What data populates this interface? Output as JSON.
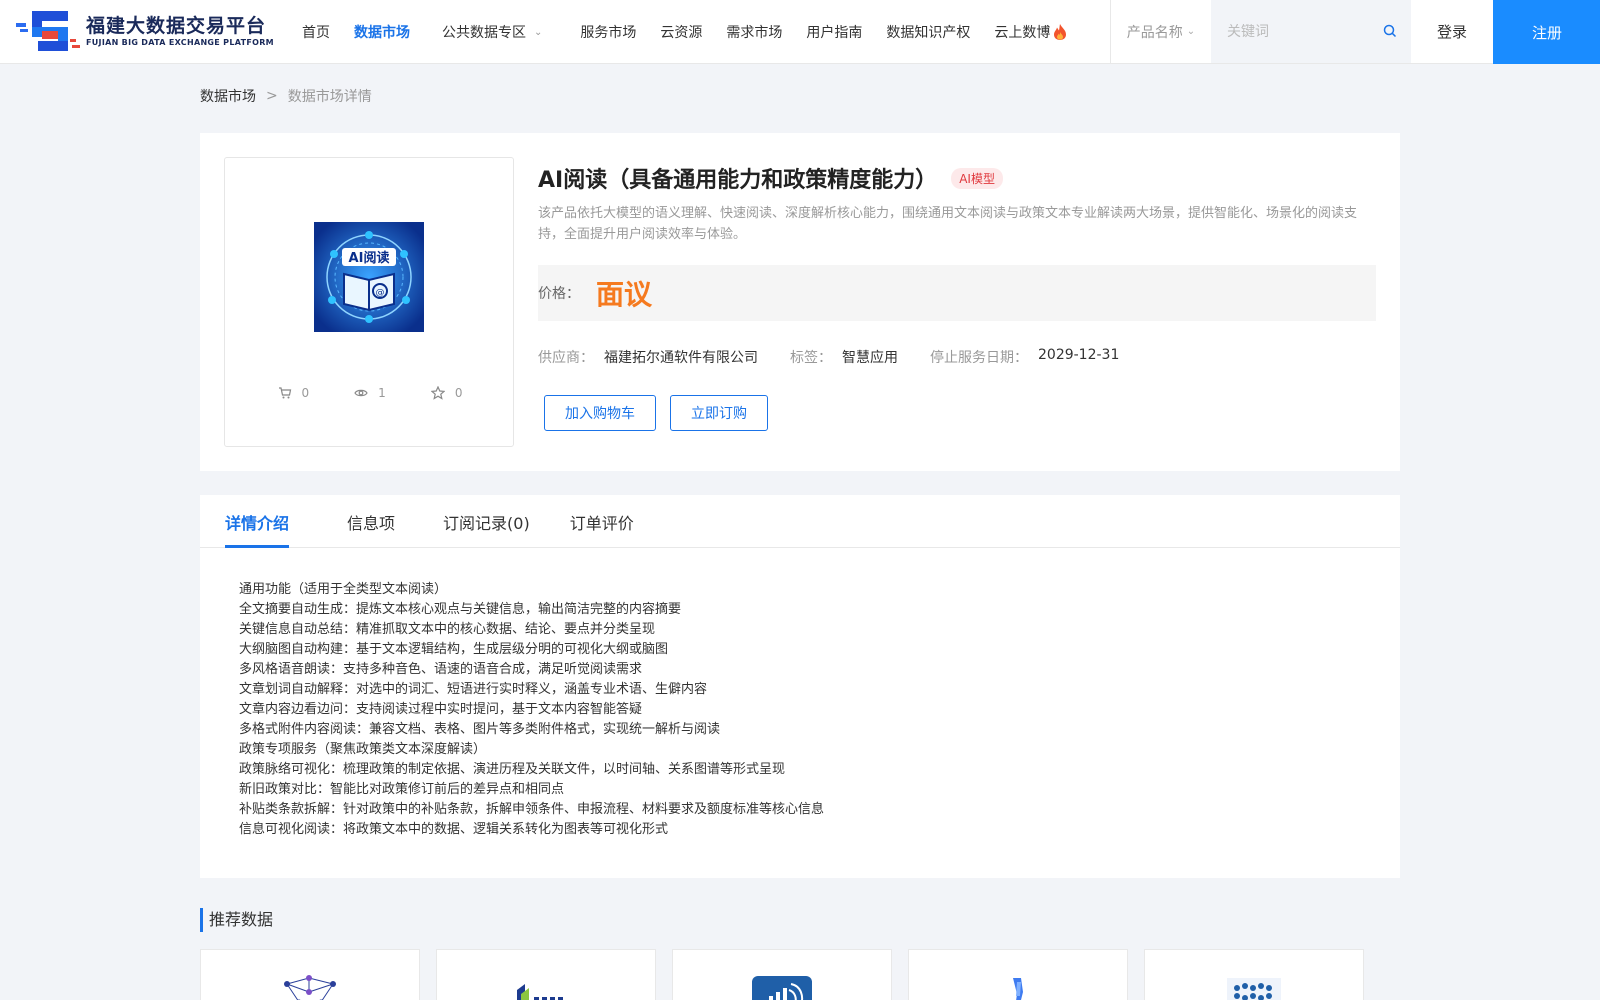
{
  "header": {
    "logo_cn": "福建大数据交易平台",
    "logo_en": "FUJIAN BIG DATA EXCHANGE  PLATFORM",
    "nav": [
      {
        "label": "首页",
        "active": false
      },
      {
        "label": "数据市场",
        "active": true
      },
      {
        "label": "公共数据专区",
        "active": false,
        "dropdown": true
      },
      {
        "label": "服务市场",
        "active": false
      },
      {
        "label": "云资源",
        "active": false
      },
      {
        "label": "需求市场",
        "active": false
      },
      {
        "label": "用户指南",
        "active": false
      },
      {
        "label": "数据知识产权",
        "active": false
      },
      {
        "label": "云上数博",
        "active": false,
        "hot": true
      }
    ],
    "search": {
      "category": "产品名称",
      "placeholder": "关键词"
    },
    "login_label": "登录",
    "register_label": "注册"
  },
  "breadcrumb": {
    "root": "数据市场",
    "separator": ">",
    "current": "数据市场详情"
  },
  "product": {
    "image_text": "AI阅读",
    "stats": {
      "cart": "0",
      "views": "1",
      "favorites": "0"
    },
    "title": "AI阅读（具备通用能力和政策精度能力）",
    "badge": "AI模型",
    "description": "该产品依托大模型的语义理解、快速阅读、深度解析核心能力，围绕通用文本阅读与政策文本专业解读两大场景，提供智能化、场景化的阅读支持，全面提升用户阅读效率与体验。",
    "price_label": "价格：",
    "price_value": "面议",
    "supplier_label": "供应商：",
    "supplier": "福建拓尔通软件有限公司",
    "tag_label": "标签：",
    "tag": "智慧应用",
    "end_date_label": "停止服务日期：",
    "end_date": "2029-12-31",
    "add_cart_label": "加入购物车",
    "order_label": "立即订购"
  },
  "tabs": [
    {
      "label": "详情介绍",
      "active": true
    },
    {
      "label": "信息项",
      "active": false
    },
    {
      "label": "订阅记录(0)",
      "active": false
    },
    {
      "label": "订单评价",
      "active": false
    }
  ],
  "detail_lines": [
    "通用功能（适用于全类型文本阅读）",
    "全文摘要自动生成：提炼文本核心观点与关键信息，输出简洁完整的内容摘要",
    "关键信息自动总结：精准抓取文本中的核心数据、结论、要点并分类呈现",
    "大纲脑图自动构建：基于文本逻辑结构，生成层级分明的可视化大纲或脑图",
    "多风格语音朗读：支持多种音色、语速的语音合成，满足听觉阅读需求",
    "文章划词自动解释：对选中的词汇、短语进行实时释义，涵盖专业术语、生僻内容",
    "文章内容边看边问：支持阅读过程中实时提问，基于文本内容智能答疑",
    "多格式附件内容阅读：兼容文档、表格、图片等多类附件格式，实现统一解析与阅读",
    "政策专项服务（聚焦政策类文本深度解读）",
    "政策脉络可视化：梳理政策的制定依据、演进历程及关联文件，以时间轴、关系图谱等形式呈现",
    "新旧政策对比：智能比对政策修订前后的差异点和相同点",
    "补贴类条款拆解：针对政策中的补贴条款，拆解申领条件、申报流程、材料要求及额度标准等核心信息",
    "信息可视化阅读：将政策文本中的数据、逻辑关系转化为图表等可视化形式"
  ],
  "recommend": {
    "title": "推荐数据"
  },
  "colors": {
    "accent": "#1a73e8",
    "register_bg": "#1a8cff",
    "price": "#f57a1f",
    "badge": "#e0393e"
  }
}
